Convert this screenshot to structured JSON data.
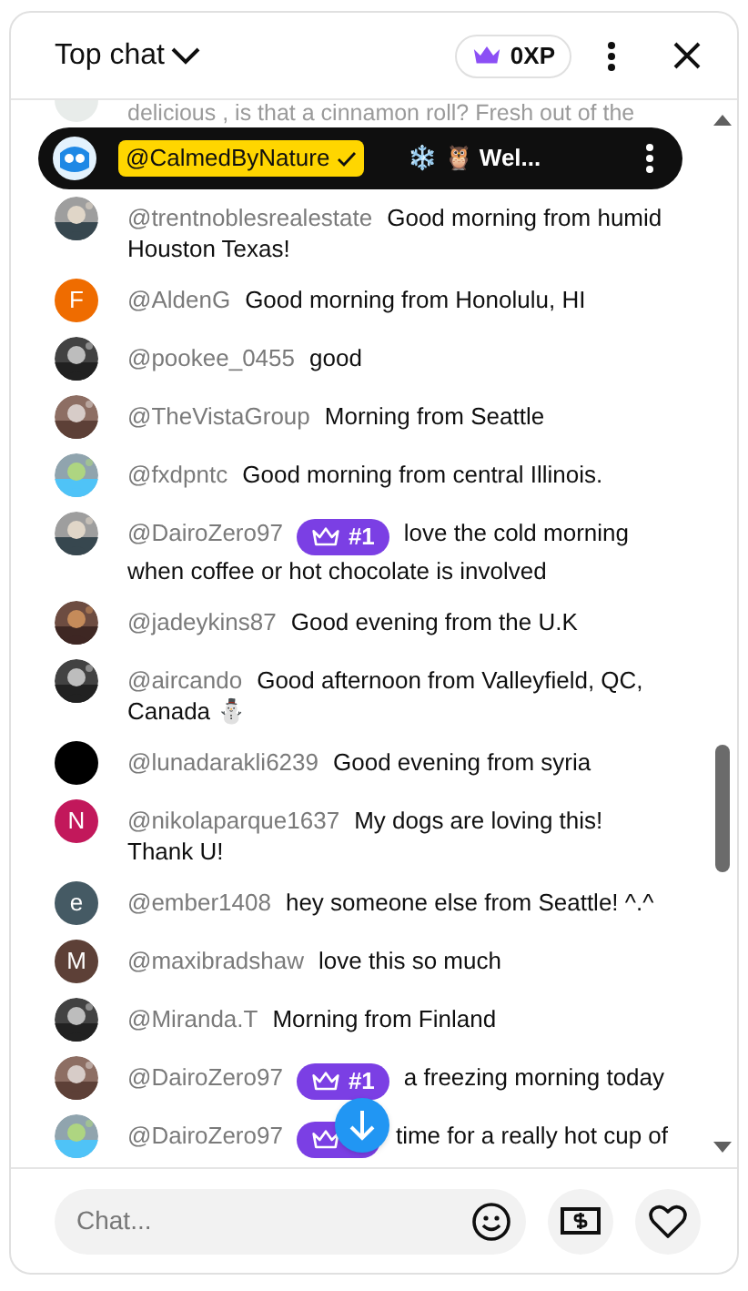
{
  "header": {
    "title": "Top chat",
    "xp": "0XP"
  },
  "pinned": {
    "username": "@CalmedByNature",
    "text": "❄️ 🦉 Wel..."
  },
  "faded_message": {
    "text": "delicious , is that a cinnamon roll? Fresh out of the"
  },
  "messages": [
    {
      "username": "@trentnoblesrealestate",
      "text": "Good morning from humid",
      "text_line_2": "Houston Texas!"
    },
    {
      "username": "@AldenG",
      "text": "Good morning from Honolulu, HI",
      "avatar": {
        "kind": "letter",
        "letter": "F",
        "color": "#ef6c00"
      }
    },
    {
      "username": "@pookee_0455",
      "text": "good"
    },
    {
      "username": "@TheVistaGroup",
      "text": "Morning from Seattle"
    },
    {
      "username": "@fxdpntc",
      "text": "Good morning from central Illinois."
    },
    {
      "username": "@DairoZero97",
      "badge": "#1",
      "text": "love the cold morning",
      "text_line_2": "when coffee or hot chocolate is involved"
    },
    {
      "username": "@jadeykins87",
      "text": "Good evening from the U.K"
    },
    {
      "username": "@aircando",
      "text": "Good afternoon from Valleyfield, QC,",
      "text_line_2": "Canada ⛄"
    },
    {
      "username": "@lunadarakli6239",
      "text": "Good evening from syria",
      "avatar": {
        "kind": "solid",
        "color": "#000000"
      }
    },
    {
      "username": "@nikolaparque1637",
      "text": "My dogs are loving this!",
      "text_line_2": "Thank U!",
      "avatar": {
        "kind": "letter",
        "letter": "N",
        "color": "#c2185b"
      }
    },
    {
      "username": "@ember1408",
      "text": "hey someone else from Seattle! ^.^",
      "avatar": {
        "kind": "letter",
        "letter": "e",
        "color": "#455a64"
      }
    },
    {
      "username": "@maxibradshaw",
      "text": "love this so much",
      "avatar": {
        "kind": "letter",
        "letter": "M",
        "color": "#5d4037"
      }
    },
    {
      "username": "@Miranda.T",
      "text": "Morning from Finland"
    },
    {
      "username": "@DairoZero97",
      "badge": "#1",
      "text": "a freezing morning today"
    },
    {
      "username": "@DairoZero97",
      "crown_badge": true,
      "text": "time for a really hot cup of"
    }
  ],
  "input": {
    "placeholder": "Chat..."
  }
}
